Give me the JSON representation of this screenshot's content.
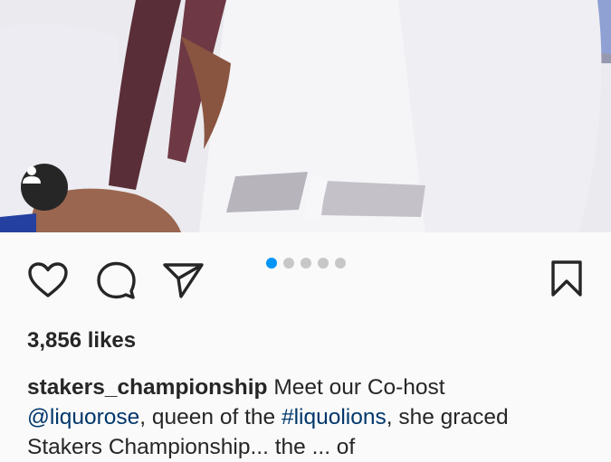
{
  "post": {
    "image_alt": "Photo of co-host in white outfit",
    "carousel": {
      "count": 5,
      "active_index": 0
    },
    "likes_text": "3,856 likes",
    "caption": {
      "username": "stakers_championship",
      "text1": " Meet our Co-host",
      "mention": "@liquorose",
      "text2": ", queen of the ",
      "hashtag": "#liquolions",
      "text3": ", she graced",
      "line3_partial": "Stakers Championship... the ... of"
    }
  },
  "icons": {
    "tag": "person-tag-icon",
    "like": "heart-icon",
    "comment": "comment-bubble-icon",
    "share": "paper-plane-icon",
    "save": "bookmark-icon"
  },
  "colors": {
    "accent": "#0095f6",
    "link": "#00376b",
    "text": "#262626"
  }
}
